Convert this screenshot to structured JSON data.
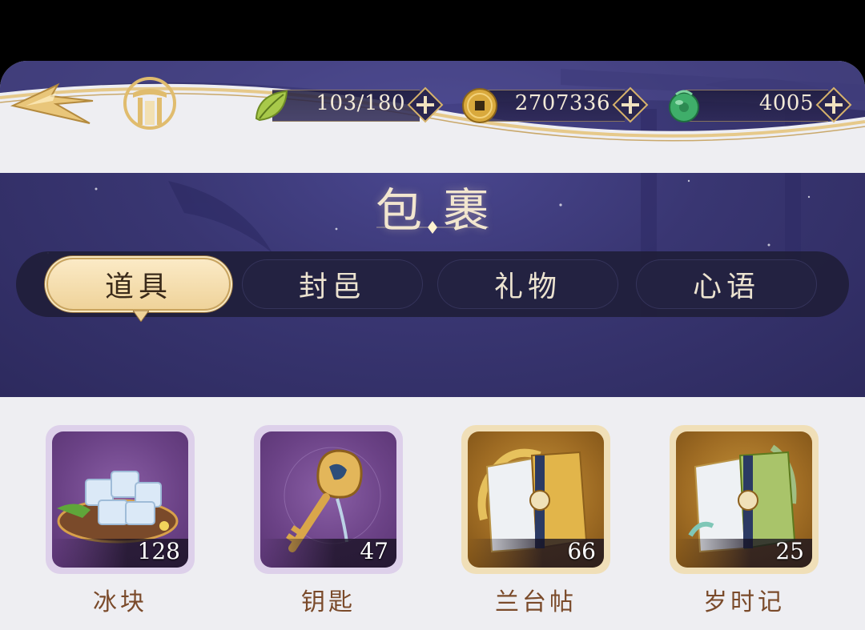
{
  "header": {
    "title": "包裹"
  },
  "resources": [
    {
      "icon": "leaf-icon",
      "value": "103/180"
    },
    {
      "icon": "coin-icon",
      "value": "2707336"
    },
    {
      "icon": "jade-icon",
      "value": "4005"
    }
  ],
  "tabs": [
    {
      "label": "道具",
      "active": true
    },
    {
      "label": "封邑",
      "active": false
    },
    {
      "label": "礼物",
      "active": false
    },
    {
      "label": "心语",
      "active": false
    }
  ],
  "items": [
    {
      "name": "冰块",
      "count": "128",
      "rarity": "purple"
    },
    {
      "name": "钥匙",
      "count": "47",
      "rarity": "purple"
    },
    {
      "name": "兰台帖",
      "count": "66",
      "rarity": "gold"
    },
    {
      "name": "岁时记",
      "count": "25",
      "rarity": "gold"
    }
  ],
  "colors": {
    "header_bg": "#393672",
    "tab_active": "#f7e1b0",
    "tab_inactive": "#232241",
    "panel_bg": "#eeeef2",
    "item_name": "#7a4a2a"
  }
}
